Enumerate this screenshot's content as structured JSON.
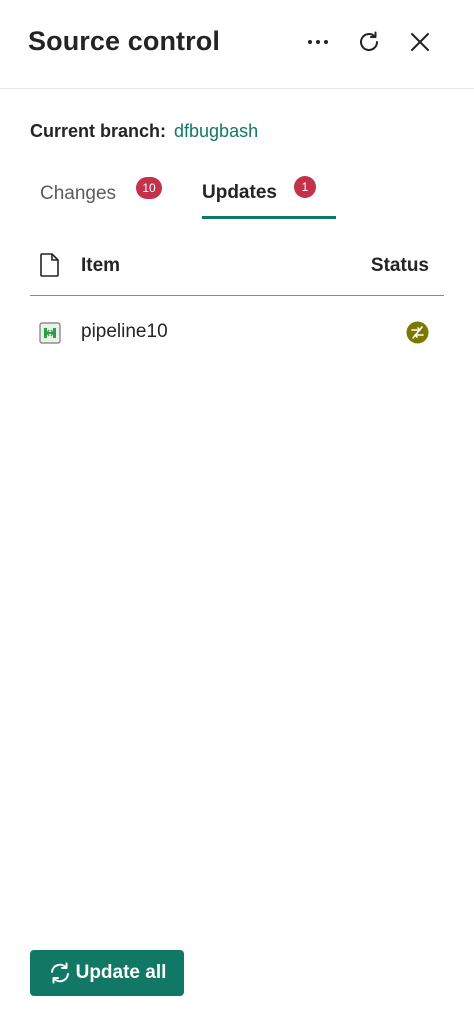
{
  "header": {
    "title": "Source control",
    "more_icon": "more-horizontal-icon",
    "refresh_icon": "refresh-icon",
    "close_icon": "close-icon"
  },
  "branch": {
    "label": "Current branch:",
    "name": "dfbugbash"
  },
  "tabs": [
    {
      "label": "Changes",
      "count": "10",
      "selected": false
    },
    {
      "label": "Updates",
      "count": "1",
      "selected": true
    }
  ],
  "table": {
    "columns": [
      "Item",
      "Status"
    ],
    "rows": [
      {
        "name": "pipeline10",
        "type_icon": "pipeline-icon",
        "status_icon": "update-required-icon"
      }
    ]
  },
  "footer": {
    "update_all_label": "Update all"
  },
  "colors": {
    "accent": "#117865",
    "badge": "#c4314b",
    "status_icon": "#7a7a00"
  }
}
